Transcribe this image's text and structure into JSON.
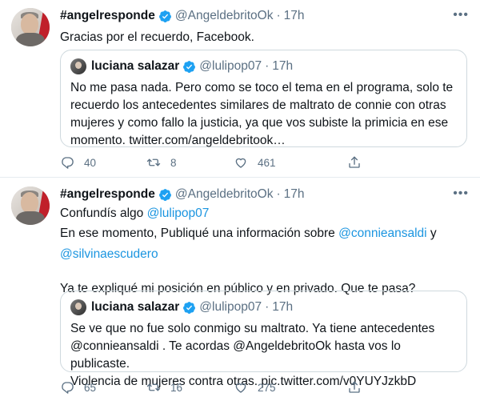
{
  "tweets": [
    {
      "author": {
        "name": "#angelresponde",
        "handle": "@AngeldebritoOk",
        "time": "17h"
      },
      "text_lines": [
        "Gracias por el recuerdo, Facebook."
      ],
      "quote": {
        "author": {
          "name": "luciana salazar",
          "handle": "@lulipop07",
          "time": "17h"
        },
        "text_lines": [
          "No me pasa nada. Pero como se toco el tema en el programa, solo te",
          "recuerdo los antecedentes similares de maltrato de connie con otras",
          "mujeres y como fallo la justicia, ya que vos subiste la primicia en ese",
          "momento. twitter.com/angeldebritook…"
        ]
      },
      "actions": {
        "replies": "40",
        "retweets": "8",
        "likes": "461"
      }
    },
    {
      "author": {
        "name": "#angelresponde",
        "handle": "@AngeldebritoOk",
        "time": "17h"
      },
      "text": {
        "line1_prefix": "Confundís algo ",
        "line1_mention": "@lulipop07",
        "line2_prefix": "En ese momento, Publiqué una información sobre ",
        "line2_mention": "@connieansaldi",
        "line2_suffix": " y",
        "line3_mention": "@silvinaescudero",
        "line4": "Ya te expliqué mi posición en público y en privado. Que te pasa?"
      },
      "quote": {
        "author": {
          "name": "luciana salazar",
          "handle": "@lulipop07",
          "time": "17h"
        },
        "text_lines": [
          "Se ve que no fue solo conmigo su maltrato. Ya tiene antecedentes",
          "@connieansaldi . Te acordas @AngeldebritoOk hasta vos lo publicaste.",
          "Violencia de mujeres contra otras. pic.twitter.com/v0YUYJzkbD"
        ]
      },
      "actions": {
        "replies": "65",
        "retweets": "16",
        "likes": "275"
      }
    }
  ],
  "separator": "·",
  "more_glyph": "•••",
  "colors": {
    "link": "#1b95e0",
    "verified": "#1da1f2",
    "secondary": "#5b7083",
    "border": "#cfd9de"
  },
  "icons": [
    "verified-badge-icon",
    "more-icon",
    "reply-icon",
    "retweet-icon",
    "like-icon",
    "share-icon"
  ]
}
